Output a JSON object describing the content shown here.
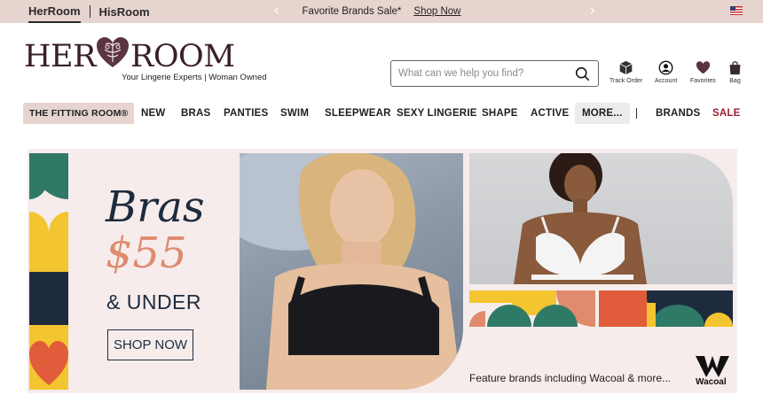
{
  "topbar": {
    "site_active": "HerRoom",
    "site_other": "HisRoom",
    "promo_text": "Favorite Brands Sale*",
    "promo_link": "Shop Now",
    "prev_arrow": "‹",
    "next_arrow": "›"
  },
  "header": {
    "logo_left": "HER",
    "logo_right": "ROOM",
    "tagline": "Your Lingerie Experts | Woman Owned",
    "search_placeholder": "What can we help you find?",
    "icons": [
      {
        "label": "Track Order",
        "icon": "box-icon"
      },
      {
        "label": "Account",
        "icon": "user-icon"
      },
      {
        "label": "Favorites",
        "icon": "heart-icon"
      },
      {
        "label": "Bag",
        "icon": "bag-icon"
      }
    ]
  },
  "nav": {
    "items": [
      "THE FITTING ROOM®",
      "NEW",
      "BRAS",
      "PANTIES",
      "SWIM",
      "SLEEPWEAR",
      "SEXY LINGERIE",
      "SHAPE",
      "ACTIVE",
      "MORE...",
      "BRANDS",
      "SALE"
    ],
    "separator": "|"
  },
  "hero": {
    "title": "Bras",
    "price": "$55",
    "subtitle": "& UNDER",
    "cta": "SHOP NOW",
    "feature_text": "Feature brands including Wacoal & more...",
    "brand_logo_text": "Wacoal"
  },
  "colors": {
    "topbar_bg": "#e6d4cf",
    "brand_dark": "#3a1f2a",
    "navy": "#1d2b3d",
    "salmon": "#e08a6e",
    "sale_red": "#9b1f2f",
    "hero_bg": "#f7ecec"
  }
}
